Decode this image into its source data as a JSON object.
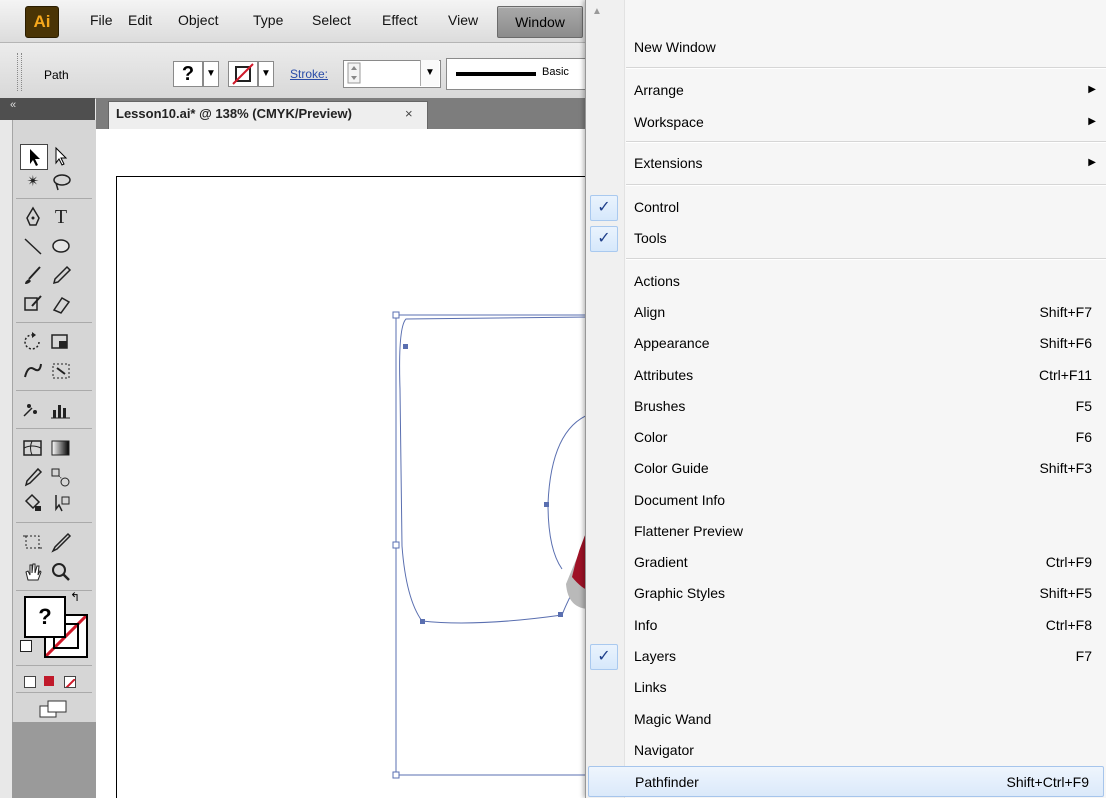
{
  "app": {
    "logo_text": "Ai",
    "menus": [
      "File",
      "Edit",
      "Object",
      "Type",
      "Select",
      "Effect",
      "View",
      "Window"
    ]
  },
  "control_bar": {
    "selection_label": "Path",
    "fill_value": "?",
    "stroke_label": "Stroke:",
    "brush_label": "Basic"
  },
  "document": {
    "tab_title": "Lesson10.ai* @ 138% (CMYK/Preview)",
    "close_glyph": "×"
  },
  "tools_panel": {
    "collapse_glyph": "«",
    "fill_value": "?"
  },
  "window_menu": {
    "items": [
      {
        "label": "New Window",
        "shortcut": "",
        "checked": false,
        "submenu": false
      },
      {
        "label": "Arrange",
        "shortcut": "",
        "checked": false,
        "submenu": true
      },
      {
        "label": "Workspace",
        "shortcut": "",
        "checked": false,
        "submenu": true
      },
      {
        "label": "Extensions",
        "shortcut": "",
        "checked": false,
        "submenu": true
      },
      {
        "label": "Control",
        "shortcut": "",
        "checked": true,
        "submenu": false
      },
      {
        "label": "Tools",
        "shortcut": "",
        "checked": true,
        "submenu": false
      },
      {
        "label": "Actions",
        "shortcut": "",
        "checked": false,
        "submenu": false
      },
      {
        "label": "Align",
        "shortcut": "Shift+F7",
        "checked": false,
        "submenu": false
      },
      {
        "label": "Appearance",
        "shortcut": "Shift+F6",
        "checked": false,
        "submenu": false
      },
      {
        "label": "Attributes",
        "shortcut": "Ctrl+F11",
        "checked": false,
        "submenu": false
      },
      {
        "label": "Brushes",
        "shortcut": "F5",
        "checked": false,
        "submenu": false
      },
      {
        "label": "Color",
        "shortcut": "F6",
        "checked": false,
        "submenu": false
      },
      {
        "label": "Color Guide",
        "shortcut": "Shift+F3",
        "checked": false,
        "submenu": false
      },
      {
        "label": "Document Info",
        "shortcut": "",
        "checked": false,
        "submenu": false
      },
      {
        "label": "Flattener Preview",
        "shortcut": "",
        "checked": false,
        "submenu": false
      },
      {
        "label": "Gradient",
        "shortcut": "Ctrl+F9",
        "checked": false,
        "submenu": false
      },
      {
        "label": "Graphic Styles",
        "shortcut": "Shift+F5",
        "checked": false,
        "submenu": false
      },
      {
        "label": "Info",
        "shortcut": "Ctrl+F8",
        "checked": false,
        "submenu": false
      },
      {
        "label": "Layers",
        "shortcut": "F7",
        "checked": true,
        "submenu": false
      },
      {
        "label": "Links",
        "shortcut": "",
        "checked": false,
        "submenu": false
      },
      {
        "label": "Magic Wand",
        "shortcut": "",
        "checked": false,
        "submenu": false
      },
      {
        "label": "Navigator",
        "shortcut": "",
        "checked": false,
        "submenu": false
      },
      {
        "label": "Pathfinder",
        "shortcut": "Shift+Ctrl+F9",
        "checked": false,
        "submenu": false,
        "highlighted": true
      }
    ],
    "check_glyph": "✓",
    "submenu_glyph": "▶",
    "scroll_glyph": "▲"
  },
  "colors": {
    "menu_highlight": "#dbe9fa",
    "accent_red": "#c0192a",
    "path_blue": "#5a6fb0",
    "logo_bg": "#4a3405",
    "logo_fg": "#f6a71c"
  }
}
